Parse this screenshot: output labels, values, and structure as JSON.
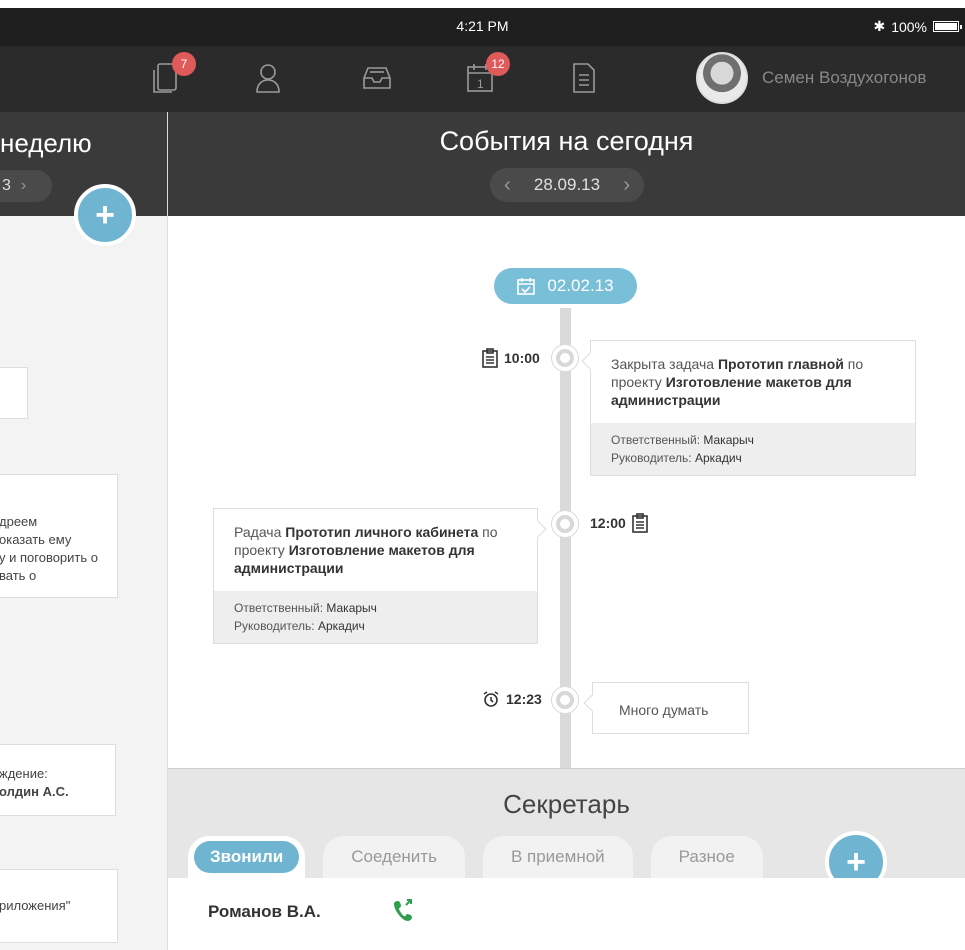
{
  "status": {
    "time": "4:21 PM",
    "battery": "100%"
  },
  "toolbar": {
    "tasks_badge": "7",
    "calendar_badge": "12",
    "calendar_day": "1",
    "user_name": "Семен Воздухогонов"
  },
  "left": {
    "title": "неделю",
    "date": "3",
    "cards": [
      {
        "text": ""
      },
      {
        "text": "дреем\nоказать ему\nу и поговорить о\nвать о"
      },
      {
        "text": "ждение:",
        "bold": "олдин А.С."
      },
      {
        "text": "риложения\""
      }
    ]
  },
  "center": {
    "title": "События на сегодня",
    "date": "28.09.13",
    "timeline_date": "02.02.13",
    "events": [
      {
        "time": "10:00",
        "text_a": "Закрыта задача ",
        "bold_a": "Прототип главной",
        "text_b": " по проекту ",
        "bold_b": "Изготовление макетов для администрации",
        "resp_label": "Ответственный: ",
        "resp": "Макарыч",
        "lead_label": "Руководитель: ",
        "lead": "Аркадич"
      },
      {
        "time": "12:00",
        "text_a": "Радача ",
        "bold_a": "Прототип личного кабинета",
        "text_b": " по проекту ",
        "bold_b": "Изготовление макетов для администрации",
        "resp_label": "Ответственный: ",
        "resp": "Макарыч",
        "lead_label": "Руководитель: ",
        "lead": "Аркадич"
      },
      {
        "time": "12:23",
        "text": "Много думать"
      }
    ]
  },
  "secretary": {
    "title": "Секретарь",
    "tabs": [
      "Звонили",
      "Соеденить",
      "В приемной",
      "Разное"
    ],
    "rows": [
      {
        "name": "Романов В.А."
      }
    ]
  },
  "colors": {
    "accent": "#6fb5d1",
    "badge": "#e05a5a",
    "header": "#3a3a3a",
    "phone": "#2e9e4f"
  }
}
